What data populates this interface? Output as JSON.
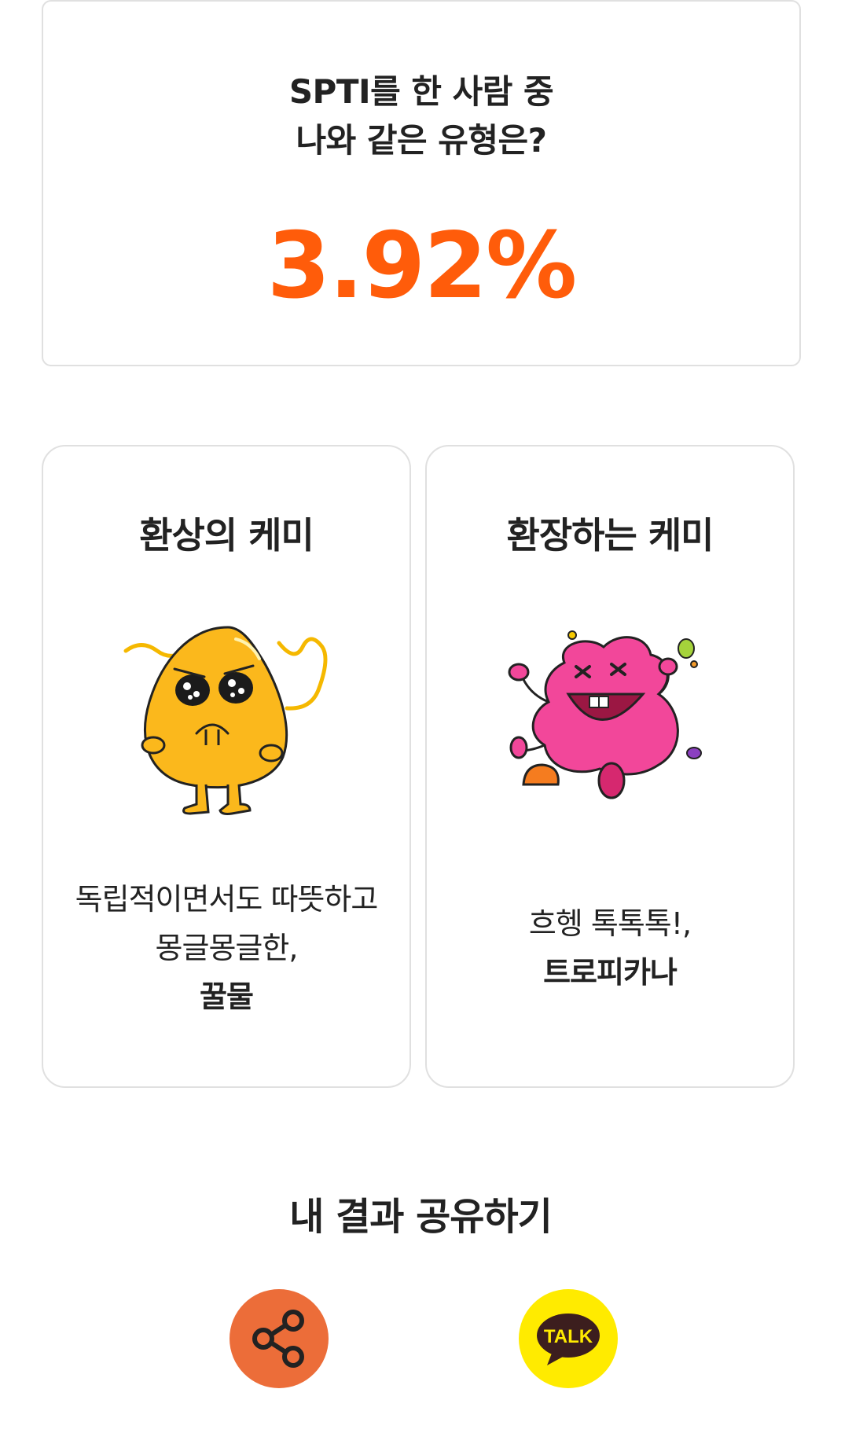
{
  "stat": {
    "question_line1": "SPTI를 한 사람 중",
    "question_line2": "나와 같은 유형은?",
    "percent": "3.92%",
    "accent_color": "#ff5c0a"
  },
  "chemistry": [
    {
      "title": "환상의 케미",
      "desc_line1": "독립적이면서도 따뜻하고",
      "desc_line2": "몽글몽글한,",
      "name": "꿀물",
      "icon": "honey-character-icon"
    },
    {
      "title": "환장하는 케미",
      "desc_line1": "흐헹 톡톡톡!,",
      "name": "트로피카나",
      "icon": "tropical-jelly-character-icon"
    }
  ],
  "share": {
    "title": "내 결과 공유하기",
    "kakao_label": "TALK",
    "link_icon": "share-icon",
    "link_color": "#ec6d39",
    "kakao_color": "#ffeb00"
  }
}
